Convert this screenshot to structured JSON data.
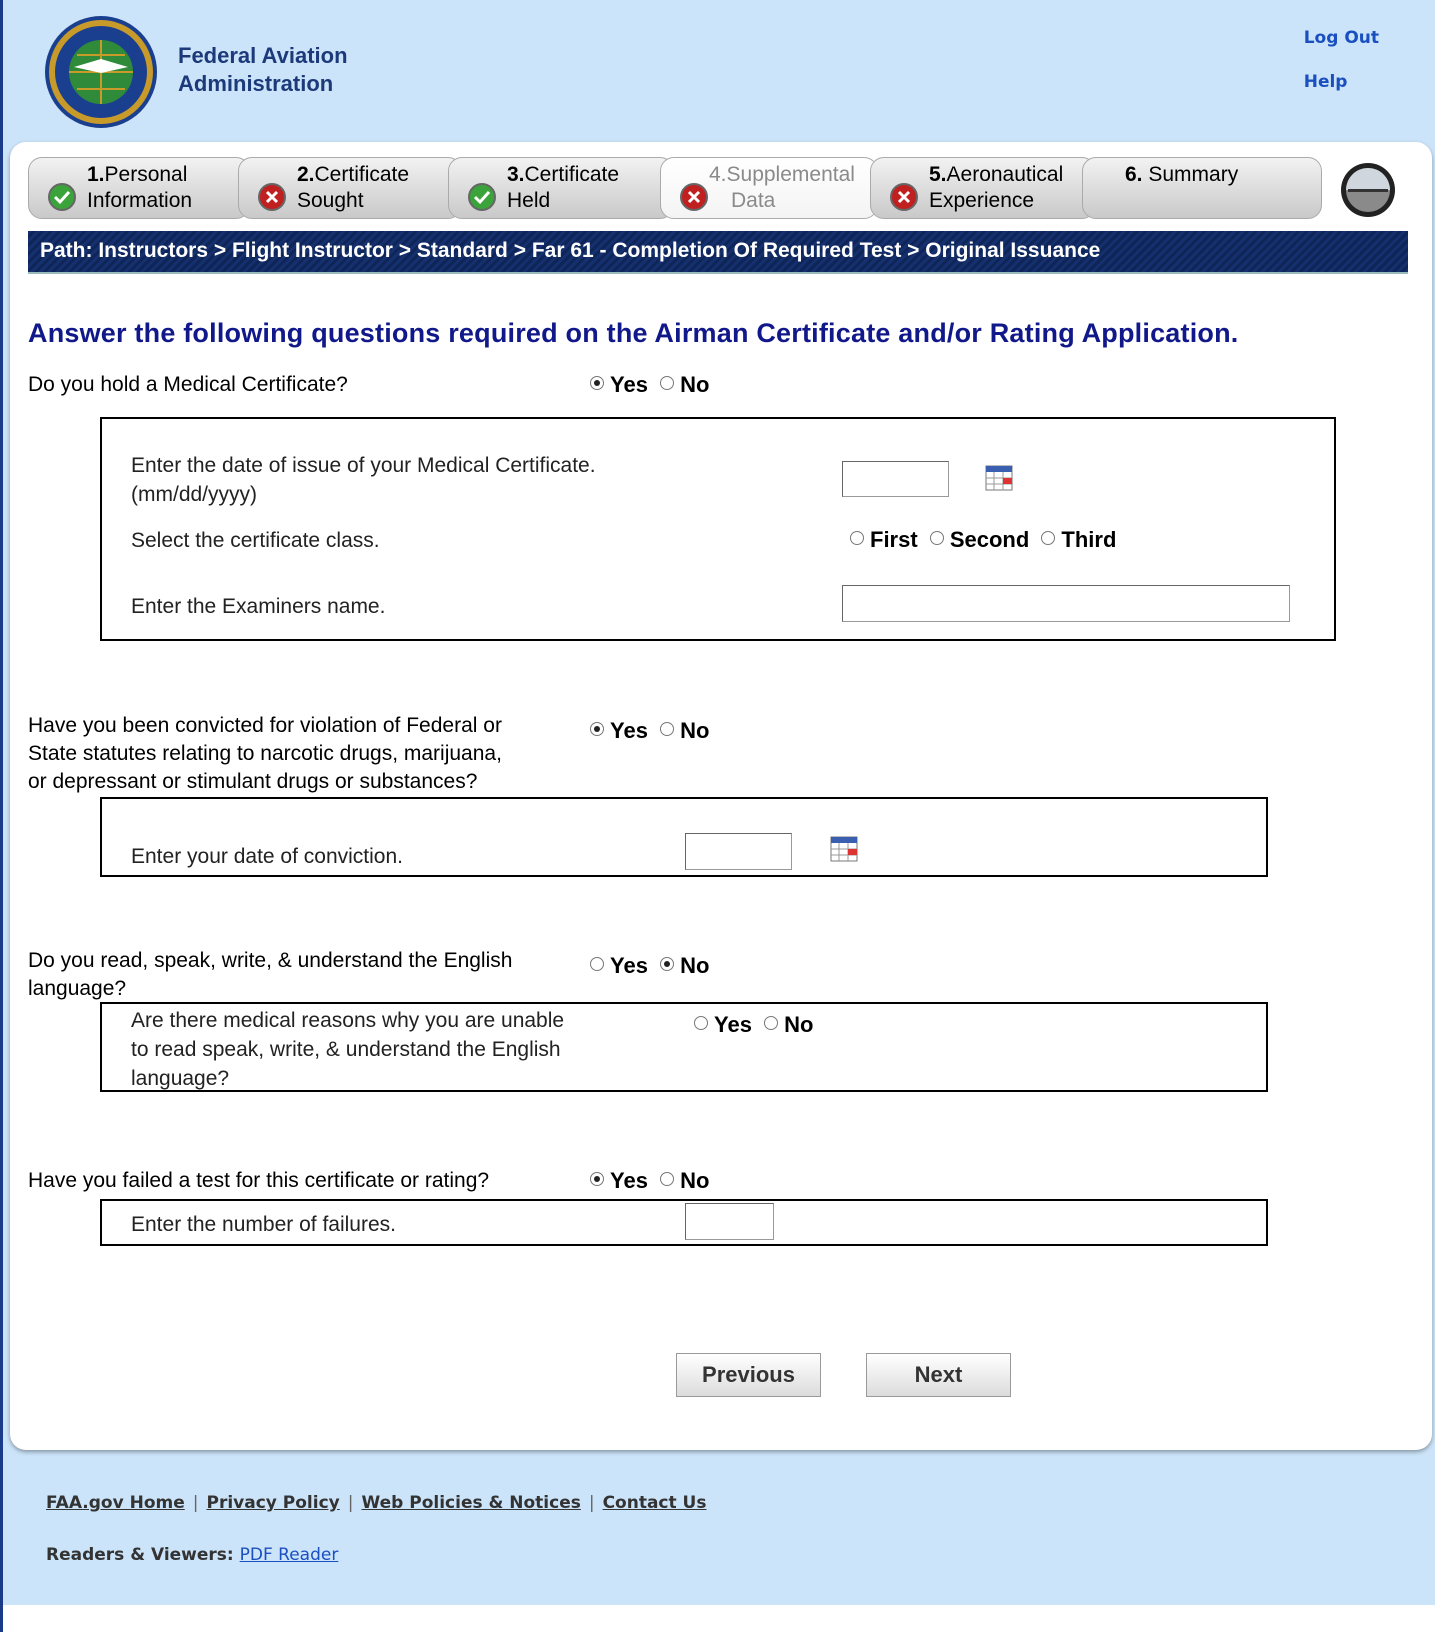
{
  "header": {
    "org_line1": "Federal Aviation",
    "org_line2": "Administration",
    "logout": "Log Out",
    "help": "Help"
  },
  "steps": [
    {
      "num": "1.",
      "line1": "Personal",
      "line2": "Information",
      "status": "check"
    },
    {
      "num": "2.",
      "line1": "Certificate",
      "line2": "Sought",
      "status": "error"
    },
    {
      "num": "3.",
      "line1": "Certificate",
      "line2": "Held",
      "status": "check"
    },
    {
      "num": "4.",
      "line1": "Supplemental",
      "line2": "Data",
      "status": "error",
      "active": true
    },
    {
      "num": "5.",
      "line1": "Aeronautical",
      "line2": "Experience",
      "status": "error"
    },
    {
      "num": "6.",
      "line1": "Summary",
      "line2": "",
      "status": "none"
    }
  ],
  "path": "Path: Instructors > Flight Instructor > Standard > Far 61 - Completion Of Required Test > Original Issuance",
  "heading": "Answer the following questions required on the Airman Certificate and/or Rating Application.",
  "q1": {
    "text": "Do you hold a Medical Certificate?",
    "yes": "Yes",
    "no": "No",
    "selected": "Yes",
    "date_label_1": "Enter the date of issue of your Medical Certificate.",
    "date_label_2": "(mm/dd/yyyy)",
    "class_label": "Select the certificate class.",
    "class_options": [
      "First",
      "Second",
      "Third"
    ],
    "examiner_label": "Enter the Examiners name."
  },
  "q2": {
    "line1": "Have you been convicted for violation of Federal or",
    "line2": "State statutes relating to narcotic drugs, marijuana,",
    "line3": "or depressant or stimulant drugs or substances?",
    "yes": "Yes",
    "no": "No",
    "selected": "Yes",
    "date_label": "Enter your date of conviction."
  },
  "q3": {
    "line1": "Do you read, speak, write, & understand the English",
    "line2": "language?",
    "yes": "Yes",
    "no": "No",
    "selected": "No",
    "sub_line1": "Are there medical reasons why you are unable",
    "sub_line2": "to read speak, write, & understand the English",
    "sub_line3": "language?",
    "sub_yes": "Yes",
    "sub_no": "No"
  },
  "q4": {
    "text": "Have you failed a test for this certificate or rating?",
    "yes": "Yes",
    "no": "No",
    "selected": "Yes",
    "failures_label": "Enter the number of failures."
  },
  "buttons": {
    "previous": "Previous",
    "next": "Next"
  },
  "footer": {
    "links": [
      "FAA.gov Home",
      "Privacy Policy",
      "Web Policies & Notices",
      "Contact Us"
    ],
    "readers_label": "Readers & Viewers:",
    "pdf_reader": "PDF Reader"
  }
}
